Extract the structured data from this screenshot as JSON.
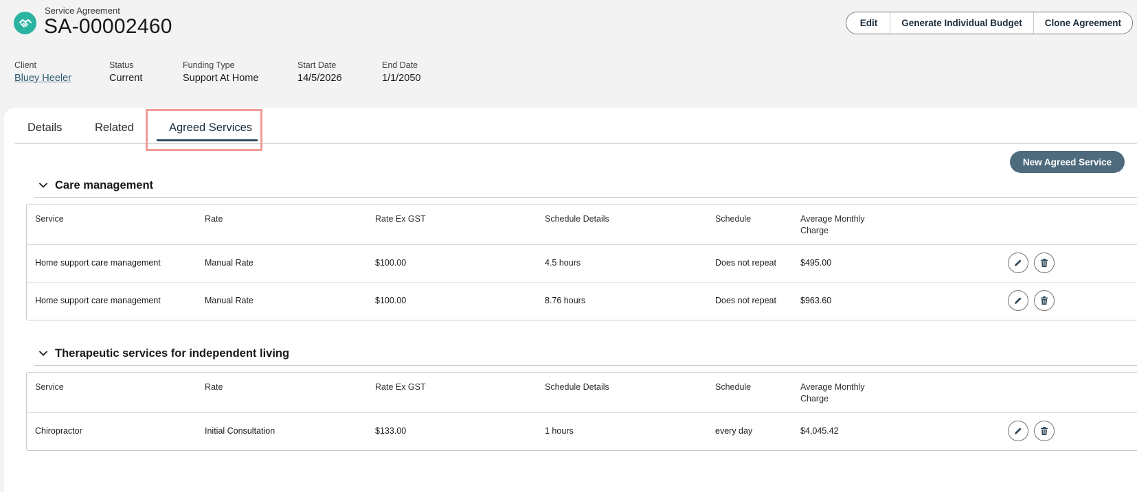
{
  "header": {
    "record_type": "Service Agreement",
    "record_number": "SA-00002460",
    "icon": "handshake-icon",
    "buttons": {
      "edit": "Edit",
      "generate_budget": "Generate Individual Budget",
      "clone": "Clone Agreement"
    }
  },
  "fields": [
    {
      "label": "Client",
      "value": "Bluey Heeler"
    },
    {
      "label": "Status",
      "value": "Current"
    },
    {
      "label": "Funding Type",
      "value": "Support At Home"
    },
    {
      "label": "Start Date",
      "value": "14/5/2026"
    },
    {
      "label": "End Date",
      "value": "1/1/2050"
    }
  ],
  "tabs": [
    {
      "label": "Details"
    },
    {
      "label": "Related"
    },
    {
      "label": "Agreed Services",
      "active": true
    }
  ],
  "new_agreed_service_label": "New Agreed Service",
  "columns": [
    "Service",
    "Rate",
    "Rate Ex GST",
    "Schedule Details",
    "Schedule",
    "Average Monthly Charge"
  ],
  "sections": [
    {
      "title": "Care management",
      "rows": [
        [
          "Home support care management",
          "Manual Rate",
          "$100.00",
          "4.5 hours",
          "Does not repeat",
          "$495.00"
        ],
        [
          "Home support care management",
          "Manual Rate",
          "$100.00",
          "8.76 hours",
          "Does not repeat",
          "$963.60"
        ]
      ]
    },
    {
      "title": "Therapeutic services for independent living",
      "rows": [
        [
          "Chiropractor",
          "Initial Consultation",
          "$133.00",
          "1 hours",
          "every day",
          "$4,045.42"
        ]
      ]
    }
  ],
  "colors": {
    "accent": "#2bb3a2",
    "primary_button": "#4e6b7d",
    "tab_underline": "#2f4a5c",
    "highlight": "#f39a95",
    "link": "#2b5870"
  }
}
